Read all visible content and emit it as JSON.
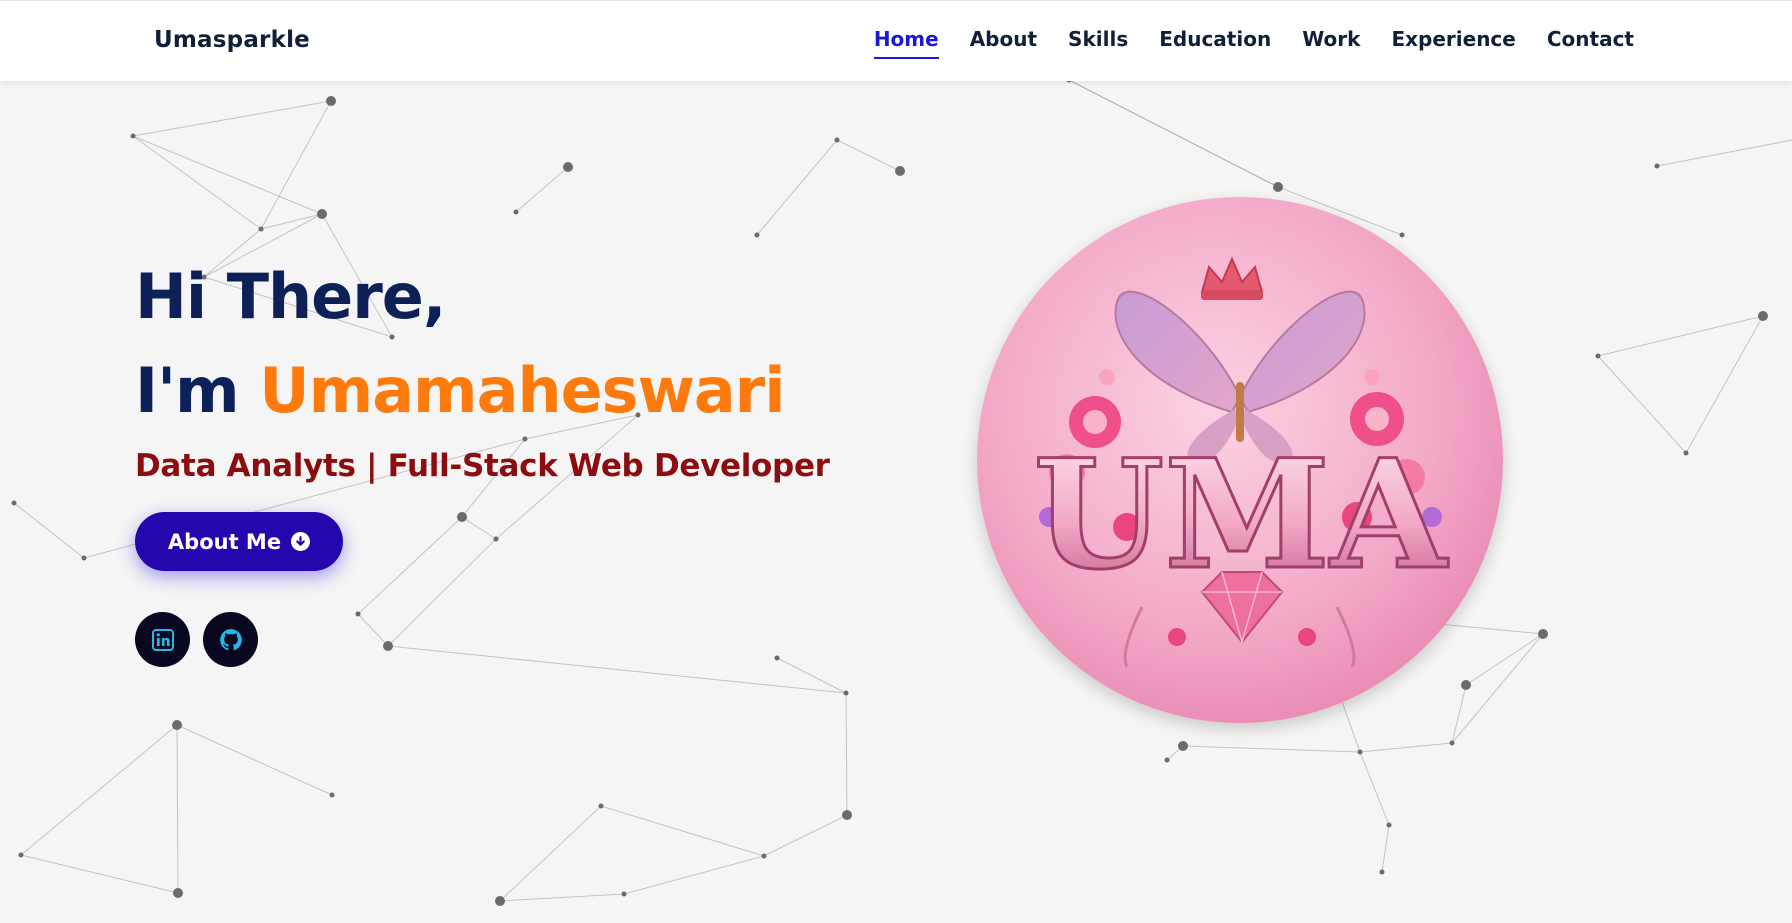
{
  "nav": {
    "brand": "Umasparkle",
    "links": [
      "Home",
      "About",
      "Skills",
      "Education",
      "Work",
      "Experience",
      "Contact"
    ],
    "active": "Home"
  },
  "hero": {
    "greeting": "Hi There,",
    "intro": "I'm",
    "name": "Umamaheswari",
    "subtitle": "Data Analyts | Full-Stack Web Developer",
    "cta_label": "About Me"
  },
  "avatar": {
    "text": "UMA"
  },
  "colors": {
    "accent": "#1a1ad6",
    "name": "#ff7a0d",
    "heading": "#0d2158",
    "subtitle": "#8b0d10",
    "button": "#2506ad",
    "social_bg": "#080820",
    "social_icon": "#29b6e8"
  },
  "icons": {
    "cta": "arrow-down-circle-icon",
    "socials": [
      "linkedin-icon",
      "github-icon"
    ]
  }
}
